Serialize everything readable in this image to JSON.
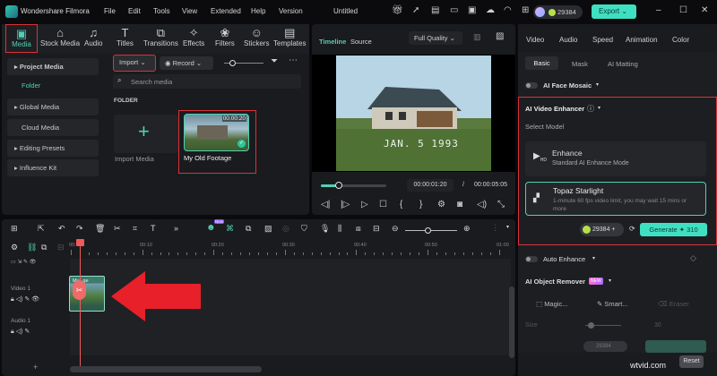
{
  "app": {
    "title": "Wondershare Filmora",
    "project": "Untitled",
    "credits": "29384",
    "export": "Export"
  },
  "menu": [
    "File",
    "Edit",
    "Tools",
    "View",
    "Extended",
    "Help",
    "Version"
  ],
  "toolbar": [
    {
      "label": "Media",
      "icon": "media-icon"
    },
    {
      "label": "Stock Media",
      "icon": "stock-icon"
    },
    {
      "label": "Audio",
      "icon": "music-icon"
    },
    {
      "label": "Titles",
      "icon": "titles-icon"
    },
    {
      "label": "Transitions",
      "icon": "transitions-icon"
    },
    {
      "label": "Effects",
      "icon": "effects-icon"
    },
    {
      "label": "Filters",
      "icon": "filters-icon"
    },
    {
      "label": "Stickers",
      "icon": "stickers-icon"
    },
    {
      "label": "Templates",
      "icon": "templates-icon"
    }
  ],
  "sidebar": {
    "items": [
      "Project Media",
      "Folder",
      "Global Media",
      "Cloud Media",
      "Editing Presets",
      "Influence Kit"
    ]
  },
  "media": {
    "import": "Import",
    "record": "Record",
    "search_placeholder": "Search media",
    "folder": "FOLDER",
    "import_media": "Import Media",
    "clip_name": "My Old Footage",
    "clip_duration": "00:00:20"
  },
  "preview": {
    "tab_timeline": "Timeline",
    "tab_source": "Source",
    "quality": "Full Quality",
    "date_stamp": "JAN. 5 1993",
    "current": "00:00:01:20",
    "sep": "/",
    "total": "00:00:05:05",
    "progress": 0.27
  },
  "right": {
    "tabs": [
      "Video",
      "Audio",
      "Speed",
      "Animation",
      "Color"
    ],
    "subtabs": [
      "Basic",
      "Mask",
      "AI Matting"
    ],
    "face_mosaic": "AI Face Mosaic",
    "enhancer": "AI Video Enhancer",
    "select_model": "Select Model",
    "model1_title": "Enhance",
    "model1_desc": "Standard AI Enhance Mode",
    "model2_title": "Topaz Starlight",
    "model2_desc": "1-minute 60 fps video limit, you may wait 15 mins or more",
    "credits": "29384",
    "generate": "Generate",
    "generate_cost": "310",
    "auto_enhance": "Auto Enhance",
    "object_remover": "AI Object Remover",
    "new_badge": "NEW",
    "tools": [
      "Magic...",
      "Smart...",
      "Eraser"
    ],
    "size_label": "Size",
    "size_value": "30",
    "credits2": "29384",
    "reset": "Reset"
  },
  "timeline": {
    "ticks": [
      "00:00",
      "00:10",
      "00:20",
      "00:30",
      "00:40",
      "00:50",
      "01:00"
    ],
    "video_track": "Video 1",
    "audio_track": "Audio 1",
    "clip_label": "My...ge",
    "new_badge": "New"
  },
  "watermark": "wtvid.com",
  "colors": {
    "accent": "#4fd1b5",
    "highlight": "#d8323a",
    "arrow": "#e8202a"
  }
}
